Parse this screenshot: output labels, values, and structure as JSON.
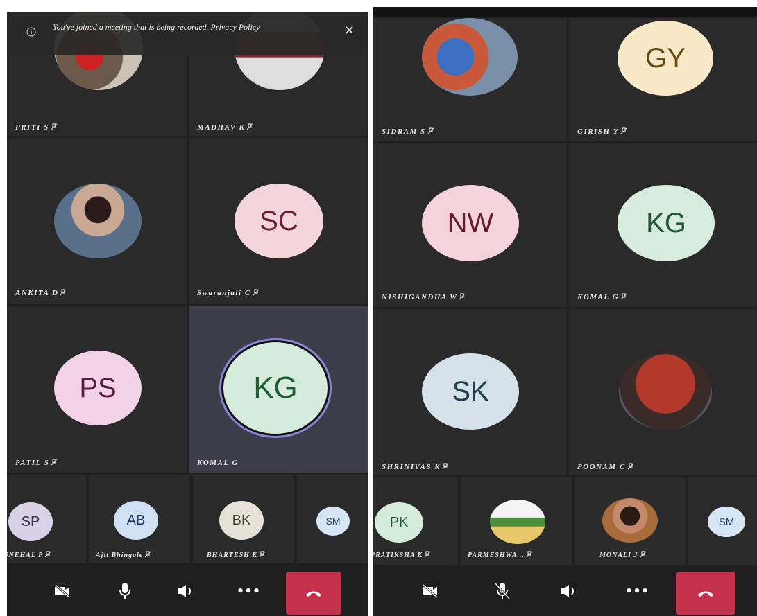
{
  "left": {
    "banner": {
      "text": "You've joined a meeting that is being recorded. Privacy Policy",
      "close": "✕"
    },
    "tiles": [
      {
        "name": "PRITI S"
      },
      {
        "name": "MADHAV K"
      },
      {
        "name": "ANKITA D"
      },
      {
        "name": "Swaranjali C",
        "initials": "SC",
        "bg": "#f3d5dc",
        "fg": "#6a1f33"
      },
      {
        "name": "PATIL S",
        "initials": "PS",
        "bg": "#f1d2e6",
        "fg": "#5a1c40"
      },
      {
        "name": "KOMAL G",
        "initials": "KG",
        "bg": "#d4ecd9",
        "fg": "#205c34"
      }
    ],
    "thumbs": [
      {
        "name": "SNEHAL P",
        "initials": "SP",
        "bg": "#d9d2e6",
        "fg": "#3a2d55"
      },
      {
        "name": "Ajit Bhingole",
        "initials": "AB",
        "bg": "#cfe0f3",
        "fg": "#1d3c63"
      },
      {
        "name": "BHARTESH K",
        "initials": "BK",
        "bg": "#e3e3d8",
        "fg": "#44443a"
      },
      {
        "initials": "SM",
        "bg": "#d7e6f5",
        "fg": "#234263"
      }
    ]
  },
  "right": {
    "tiles": [
      {
        "name": "SIDRAM S"
      },
      {
        "name": "GIRISH Y",
        "initials": "GY",
        "bg": "#f7e9c8",
        "fg": "#6a4a10"
      },
      {
        "name": "NISHIGANDHA W",
        "initials": "NW",
        "bg": "#f5d3dc",
        "fg": "#6b1b2f"
      },
      {
        "name": "KOMAL G",
        "initials": "KG",
        "bg": "#d7ecdd",
        "fg": "#1f5a34"
      },
      {
        "name": "SHRINIVAS K",
        "initials": "SK",
        "bg": "#d6e2ea",
        "fg": "#213c4d"
      },
      {
        "name": "POONAM C"
      }
    ],
    "thumbs": [
      {
        "name": "PRATIKSHA K",
        "initials": "PK",
        "bg": "#d4ecd9",
        "fg": "#205c34"
      },
      {
        "name": "PARMESHWA..."
      },
      {
        "name": "MONALI J"
      },
      {
        "initials": "SM",
        "bg": "#d7e6f5",
        "fg": "#234263"
      }
    ]
  },
  "controls": {
    "camera": "camera-off",
    "mic": "mic",
    "speaker": "speaker",
    "more": "•••",
    "hangup": "hang-up"
  }
}
